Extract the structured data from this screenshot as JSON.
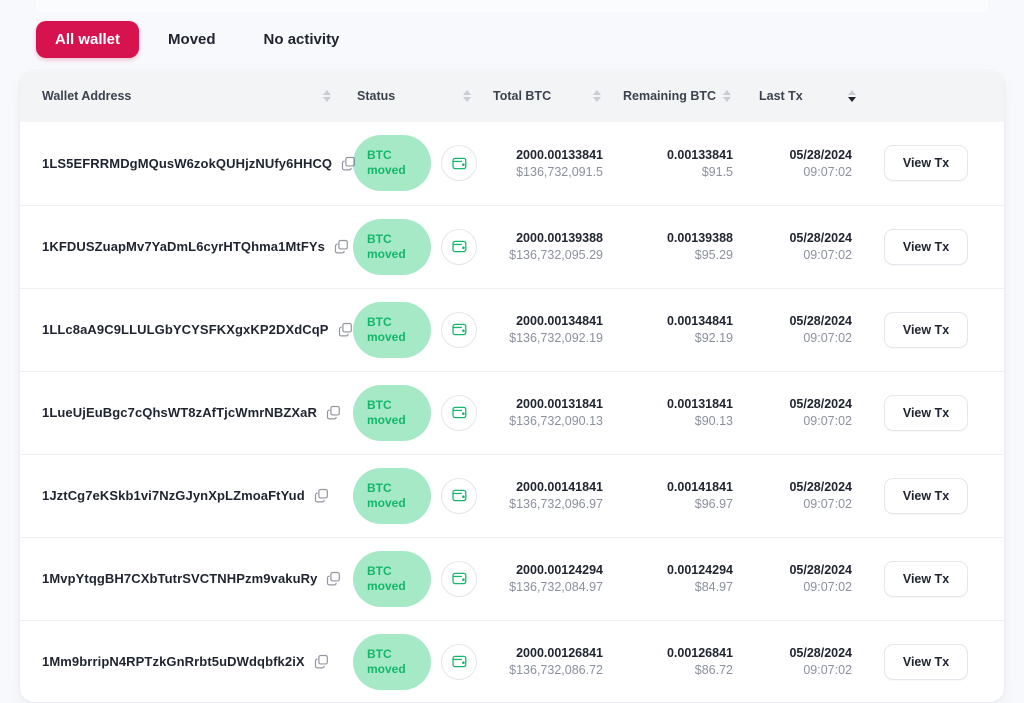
{
  "tabs": [
    {
      "label": "All wallet",
      "active": true
    },
    {
      "label": "Moved",
      "active": false
    },
    {
      "label": "No activity",
      "active": false
    }
  ],
  "table": {
    "columns": [
      {
        "label": "Wallet Address",
        "sortable": true,
        "sort_state": "none"
      },
      {
        "label": "Status",
        "sortable": true,
        "sort_state": "none"
      },
      {
        "label": "Total BTC",
        "sortable": true,
        "sort_state": "none"
      },
      {
        "label": "Remaining BTC",
        "sortable": true,
        "sort_state": "none"
      },
      {
        "label": "Last Tx",
        "sortable": true,
        "sort_state": "desc"
      },
      {
        "label": "",
        "sortable": false,
        "sort_state": "none"
      }
    ],
    "action_label": "View Tx",
    "copy_icon": "copy-icon",
    "wallet_icon": "wallet-icon",
    "rows": [
      {
        "address": "1LS5EFRRMDgMQusW6zokQUHjzNUfy6HHCQ",
        "status": "BTC moved",
        "status_line1": "BTC",
        "status_line2": "moved",
        "total_btc": "2000.00133841",
        "total_usd": "$136,732,091.5",
        "remaining_btc": "0.00133841",
        "remaining_usd": "$91.5",
        "last_tx_date": "05/28/2024",
        "last_tx_time": "09:07:02"
      },
      {
        "address": "1KFDUSZuapMv7YaDmL6cyrHTQhma1MtFYs",
        "status": "BTC moved",
        "status_line1": "BTC",
        "status_line2": "moved",
        "total_btc": "2000.00139388",
        "total_usd": "$136,732,095.29",
        "remaining_btc": "0.00139388",
        "remaining_usd": "$95.29",
        "last_tx_date": "05/28/2024",
        "last_tx_time": "09:07:02"
      },
      {
        "address": "1LLc8aA9C9LLULGbYCYSFKXgxKP2DXdCqP",
        "status": "BTC moved",
        "status_line1": "BTC",
        "status_line2": "moved",
        "total_btc": "2000.00134841",
        "total_usd": "$136,732,092.19",
        "remaining_btc": "0.00134841",
        "remaining_usd": "$92.19",
        "last_tx_date": "05/28/2024",
        "last_tx_time": "09:07:02"
      },
      {
        "address": "1LueUjEuBgc7cQhsWT8zAfTjcWmrNBZXaR",
        "status": "BTC moved",
        "status_line1": "BTC",
        "status_line2": "moved",
        "total_btc": "2000.00131841",
        "total_usd": "$136,732,090.13",
        "remaining_btc": "0.00131841",
        "remaining_usd": "$90.13",
        "last_tx_date": "05/28/2024",
        "last_tx_time": "09:07:02"
      },
      {
        "address": "1JztCg7eKSkb1vi7NzGJynXpLZmoaFtYud",
        "status": "BTC moved",
        "status_line1": "BTC",
        "status_line2": "moved",
        "total_btc": "2000.00141841",
        "total_usd": "$136,732,096.97",
        "remaining_btc": "0.00141841",
        "remaining_usd": "$96.97",
        "last_tx_date": "05/28/2024",
        "last_tx_time": "09:07:02"
      },
      {
        "address": "1MvpYtqgBH7CXbTutrSVCTNHPzm9vakuRy",
        "status": "BTC moved",
        "status_line1": "BTC",
        "status_line2": "moved",
        "total_btc": "2000.00124294",
        "total_usd": "$136,732,084.97",
        "remaining_btc": "0.00124294",
        "remaining_usd": "$84.97",
        "last_tx_date": "05/28/2024",
        "last_tx_time": "09:07:02"
      },
      {
        "address": "1Mm9brripN4RPTzkGnRrbt5uDWdqbfk2iX",
        "status": "BTC moved",
        "status_line1": "BTC",
        "status_line2": "moved",
        "total_btc": "2000.00126841",
        "total_usd": "$136,732,086.72",
        "remaining_btc": "0.00126841",
        "remaining_usd": "$86.72",
        "last_tx_date": "05/28/2024",
        "last_tx_time": "09:07:02"
      }
    ]
  },
  "colors": {
    "accent": "#d6124f",
    "badge_bg": "#a6e9c7",
    "badge_text": "#12b76a",
    "page_bg": "#f8f9fd",
    "header_bg": "#f3f4f6"
  }
}
